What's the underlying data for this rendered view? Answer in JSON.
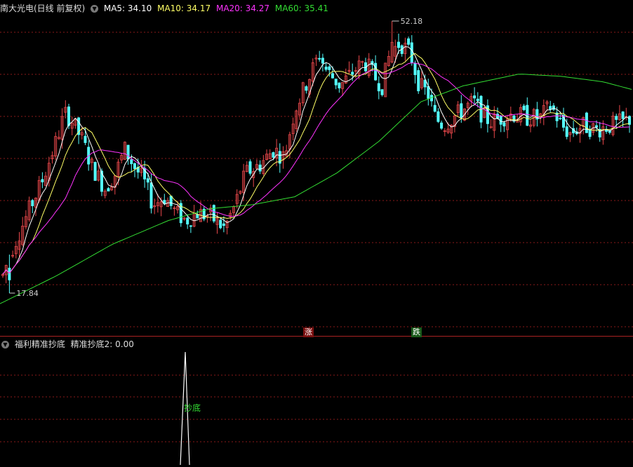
{
  "main_header": {
    "stock_label": "南大光电(日线 前复权)",
    "ma5": "MA5: 34.10",
    "ma10": "MA10: 34.17",
    "ma20": "MA20: 34.27",
    "ma60": "MA60: 35.41",
    "dropdown_icon": "chevron-down-icon"
  },
  "indicator_header": {
    "name": "福利精准抄底",
    "value": "精准抄底2: 0.00",
    "dropdown_icon": "chevron-down-icon"
  },
  "annotations": {
    "high": "52.18",
    "low": "17.84",
    "rise_badge": "涨",
    "fall_badge": "跌",
    "signal_label": "抄底"
  },
  "colors": {
    "up": "#e8474a",
    "down": "#54ffff",
    "ma5": "#ffffff",
    "ma10": "#ffff66",
    "ma20": "#ff33ff",
    "ma60": "#33dd33",
    "grid": "#8a1a1a",
    "signal": "#33dd33"
  },
  "chart_data": {
    "type": "candlestick",
    "y_axis_visible": false,
    "high_marker": 52.18,
    "low_marker": 17.84,
    "last_ma": {
      "MA5": 34.1,
      "MA10": 34.17,
      "MA20": 34.27,
      "MA60": 35.41
    },
    "indicator_last": 0.0
  }
}
